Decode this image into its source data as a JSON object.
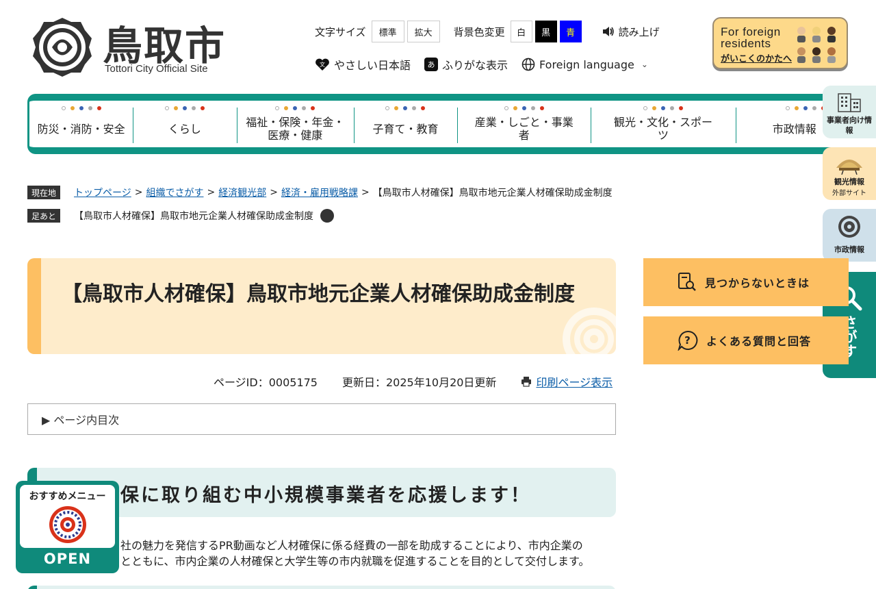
{
  "header": {
    "logo_title": "鳥取市",
    "logo_subtitle": "Tottori City Official Site",
    "font_size_label": "文字サイズ",
    "font_size_standard": "標準",
    "font_size_large": "拡大",
    "bg_color_label": "背景色変更",
    "bg_white": "白",
    "bg_black": "黒",
    "bg_blue": "青",
    "read_aloud": "読み上げ",
    "easy_japanese": "やさしい日本語",
    "furigana": "ふりがな表示",
    "furigana_icon": "あ",
    "easy_icon": "文",
    "foreign_language": "Foreign language",
    "foreign_residents_line1": "For foreign",
    "foreign_residents_line2": "residents",
    "foreign_residents_jp": "がいこくのかたへ"
  },
  "gnav": [
    {
      "label": "防災・消防・安全"
    },
    {
      "label": "くらし"
    },
    {
      "label": "福祉・保険・年金・医療・健康"
    },
    {
      "label": "子育て・教育"
    },
    {
      "label": "産業・しごと・事業者"
    },
    {
      "label": "観光・文化・スポーツ"
    },
    {
      "label": "市政情報"
    }
  ],
  "side_tabs": {
    "business": "事業者向け情報",
    "tourism": "観光情報",
    "tourism_sub": "外部サイト",
    "city": "市政情報",
    "search": "さがす"
  },
  "breadcrumb": {
    "tag": "現在地",
    "items": [
      "トップページ",
      "組織でさがす",
      "経済観光部",
      "経済・雇用戦略課"
    ],
    "current": "【鳥取市人材確保】鳥取市地元企業人材確保助成金制度",
    "footprint_tag": "足あと",
    "footprint_item": "【鳥取市人材確保】鳥取市地元企業人材確保助成金制度"
  },
  "page": {
    "title": "【鳥取市人材確保】鳥取市地元企業人材確保助成金制度",
    "page_id": "ページID：0005175",
    "updated": "更新日：2025年10月20日更新",
    "print": "印刷ページ表示",
    "toc": "▶ ページ内目次",
    "h2": "保に取り組む中小規模事業者を応援します！",
    "para_line1": "社の魅力を発信するPR動画など人材確保に係る経費の一部を助成することにより、市内企業の",
    "para_line2": "とともに、市内企業の人材確保と大学生等の市内就職を促進することを目的として交付します。"
  },
  "help": {
    "not_found": "見つからないときは",
    "faq": "よくある質問と回答"
  },
  "recommend": {
    "title": "おすすめメニュー",
    "open": "OPEN"
  },
  "colors": {
    "teal": "#0f8a7b",
    "orange": "#fdbf62",
    "title_bg": "#feeccb",
    "h2_bg": "#e2f1f0",
    "link": "#0c5ea8"
  }
}
